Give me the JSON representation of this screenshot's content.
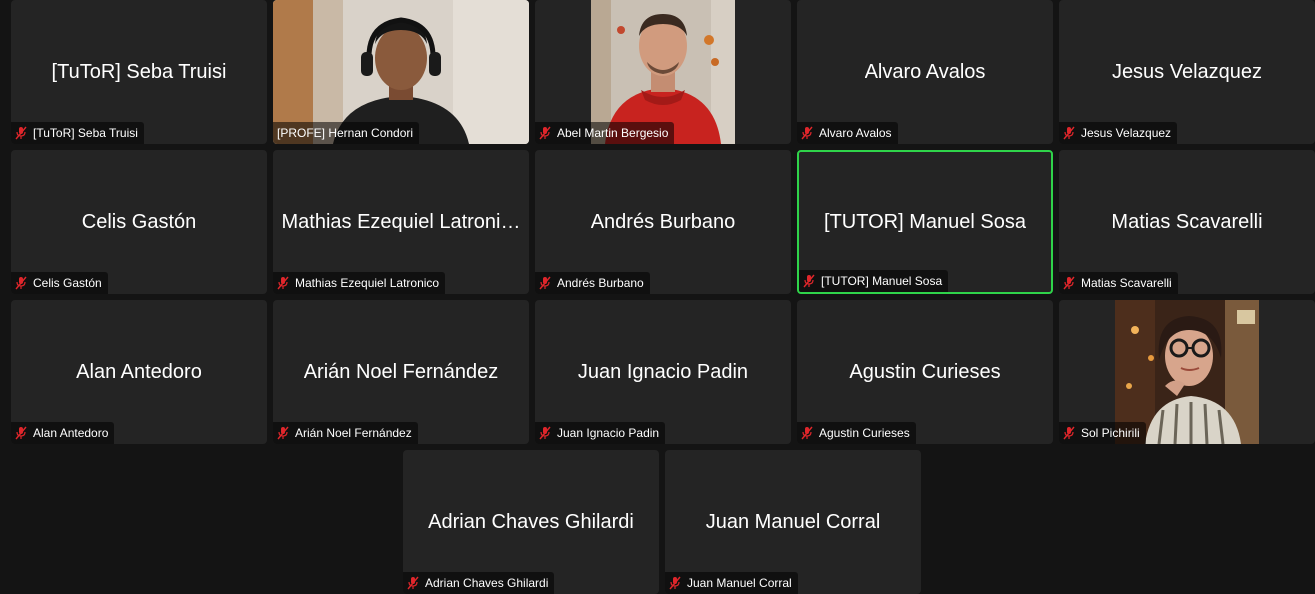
{
  "colors": {
    "background": "#141414",
    "tile": "#242424",
    "speaking_border": "#2fd44a",
    "muted_icon": "#e0262b"
  },
  "participants": [
    {
      "name": "[TuToR] Seba Truisi",
      "label": "[TuToR] Seba Truisi",
      "muted": true,
      "video": false
    },
    {
      "name": "[PROFE] Hernan Condori",
      "label": "[PROFE] Hernan Condori",
      "muted": false,
      "video": true
    },
    {
      "name": "Abel Martin Bergesio",
      "label": "Abel Martin Bergesio",
      "muted": true,
      "video": true
    },
    {
      "name": "Alvaro Avalos",
      "label": "Alvaro Avalos",
      "muted": true,
      "video": false
    },
    {
      "name": "Jesus Velazquez",
      "label": "Jesus Velazquez",
      "muted": true,
      "video": false
    },
    {
      "name": "Celis Gastón",
      "label": "Celis Gastón",
      "muted": true,
      "video": false
    },
    {
      "name": "Mathias Ezequiel Latroni…",
      "label": "Mathias Ezequiel Latronico",
      "muted": true,
      "video": false
    },
    {
      "name": "Andrés Burbano",
      "label": "Andrés Burbano",
      "muted": true,
      "video": false
    },
    {
      "name": "[TUTOR] Manuel Sosa",
      "label": "[TUTOR] Manuel Sosa",
      "muted": false,
      "video": false,
      "speaking": true
    },
    {
      "name": "Matias Scavarelli",
      "label": "Matias Scavarelli",
      "muted": true,
      "video": false
    },
    {
      "name": "Alan Antedoro",
      "label": "Alan Antedoro",
      "muted": true,
      "video": false
    },
    {
      "name": "Arián Noel Fernández",
      "label": "Arián Noel Fernández",
      "muted": true,
      "video": false
    },
    {
      "name": "Juan Ignacio Padin",
      "label": "Juan Ignacio Padin",
      "muted": true,
      "video": false
    },
    {
      "name": "Agustin Curieses",
      "label": "Agustin Curieses",
      "muted": true,
      "video": false
    },
    {
      "name": "Sol Pichirili",
      "label": "Sol Pichirili",
      "muted": true,
      "video": true
    },
    {
      "name": "Adrian Chaves Ghilardi",
      "label": "Adrian Chaves Ghilardi",
      "muted": true,
      "video": false
    },
    {
      "name": "Juan Manuel Corral",
      "label": "Juan Manuel Corral",
      "muted": true,
      "video": false
    }
  ]
}
